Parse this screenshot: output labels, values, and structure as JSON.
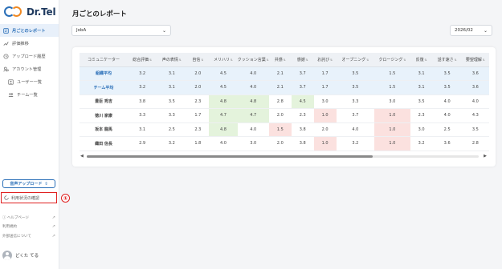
{
  "brand": {
    "logo_text": "Dr.Tel"
  },
  "sidebar": {
    "items": [
      {
        "label": "月ごとのレポート",
        "icon": "report-icon",
        "active": true
      },
      {
        "label": "評価推移",
        "icon": "trend-icon",
        "active": false
      },
      {
        "label": "アップロード履歴",
        "icon": "history-icon",
        "active": false
      },
      {
        "label": "アカウント管理",
        "icon": "account-icon",
        "active": false
      },
      {
        "label": "ユーザー一覧",
        "icon": "user-list-icon",
        "active": false,
        "sub": true
      },
      {
        "label": "チーム一覧",
        "icon": "team-list-icon",
        "active": false,
        "sub": true
      }
    ],
    "upload_label": "音声アップロード",
    "upload_icon_glyph": "⇧",
    "usage_label": "利用状況の確認",
    "annotation_number": "①",
    "links": [
      {
        "label": "ヘルプページ"
      },
      {
        "label": "利用規約"
      },
      {
        "label": "外部送信について"
      }
    ],
    "user_name": "どくた てる"
  },
  "main": {
    "title": "月ごとのレポート",
    "job_select": "JobA",
    "month_select": "2026/02"
  },
  "table": {
    "headers": [
      "コミュニケーター",
      "総合評価",
      "声の表情",
      "自信",
      "メリハリ",
      "クッション言葉",
      "共感",
      "感謝",
      "お詫び",
      "オープニング",
      "クロージング",
      "反復",
      "話す速さ",
      "要望理解"
    ],
    "rows": [
      {
        "name": "組織平均",
        "type": "avg",
        "values": [
          "3.2",
          "3.1",
          "2.0",
          "4.5",
          "4.0",
          "2.1",
          "3.7",
          "1.7",
          "3.5",
          "1.5",
          "3.1",
          "3.5",
          "3.6"
        ],
        "flags": [
          "",
          "",
          "",
          "",
          "",
          "",
          "",
          "",
          "",
          "",
          "",
          "",
          ""
        ]
      },
      {
        "name": "チーム平均",
        "type": "avg",
        "values": [
          "3.2",
          "3.1",
          "2.0",
          "4.5",
          "4.0",
          "2.1",
          "3.7",
          "1.7",
          "3.5",
          "1.5",
          "3.1",
          "3.5",
          "3.6"
        ],
        "flags": [
          "",
          "",
          "",
          "",
          "",
          "",
          "",
          "",
          "",
          "",
          "",
          "",
          ""
        ]
      },
      {
        "name": "豊臣 秀吉",
        "type": "person",
        "values": [
          "3.8",
          "3.5",
          "2.3",
          "4.8",
          "4.8",
          "2.8",
          "4.5",
          "3.0",
          "3.3",
          "3.0",
          "3.5",
          "4.0",
          "4.0"
        ],
        "flags": [
          "",
          "",
          "",
          "good",
          "good",
          "",
          "good",
          "",
          "",
          "",
          "",
          "",
          ""
        ]
      },
      {
        "name": "徳川 家康",
        "type": "person",
        "values": [
          "3.3",
          "3.3",
          "1.7",
          "4.7",
          "4.7",
          "2.0",
          "2.3",
          "1.0",
          "3.7",
          "1.0",
          "2.3",
          "4.0",
          "4.3"
        ],
        "flags": [
          "",
          "",
          "",
          "good",
          "good",
          "",
          "",
          "bad",
          "",
          "bad",
          "",
          "",
          ""
        ]
      },
      {
        "name": "坂本 龍馬",
        "type": "person",
        "values": [
          "3.1",
          "2.5",
          "2.3",
          "4.8",
          "4.0",
          "1.5",
          "3.8",
          "2.0",
          "4.0",
          "1.0",
          "3.0",
          "2.5",
          "3.5"
        ],
        "flags": [
          "",
          "",
          "",
          "good",
          "",
          "bad",
          "",
          "",
          "",
          "bad",
          "",
          "",
          ""
        ]
      },
      {
        "name": "織田 信長",
        "type": "person",
        "values": [
          "2.9",
          "3.2",
          "1.8",
          "4.0",
          "3.0",
          "2.0",
          "3.8",
          "1.0",
          "3.2",
          "1.0",
          "3.2",
          "3.6",
          "2.8"
        ],
        "flags": [
          "",
          "",
          "",
          "",
          "",
          "",
          "",
          "bad",
          "",
          "bad",
          "",
          "",
          ""
        ]
      }
    ]
  },
  "scroll": {
    "position_fraction": 0.0,
    "visible_fraction": 0.73
  },
  "colors": {
    "accent": "#2a6fb8",
    "good": "#e4f3dc",
    "bad": "#fbe1df",
    "avg_row": "#e8f2fb",
    "highlight_border": "#e02020"
  }
}
